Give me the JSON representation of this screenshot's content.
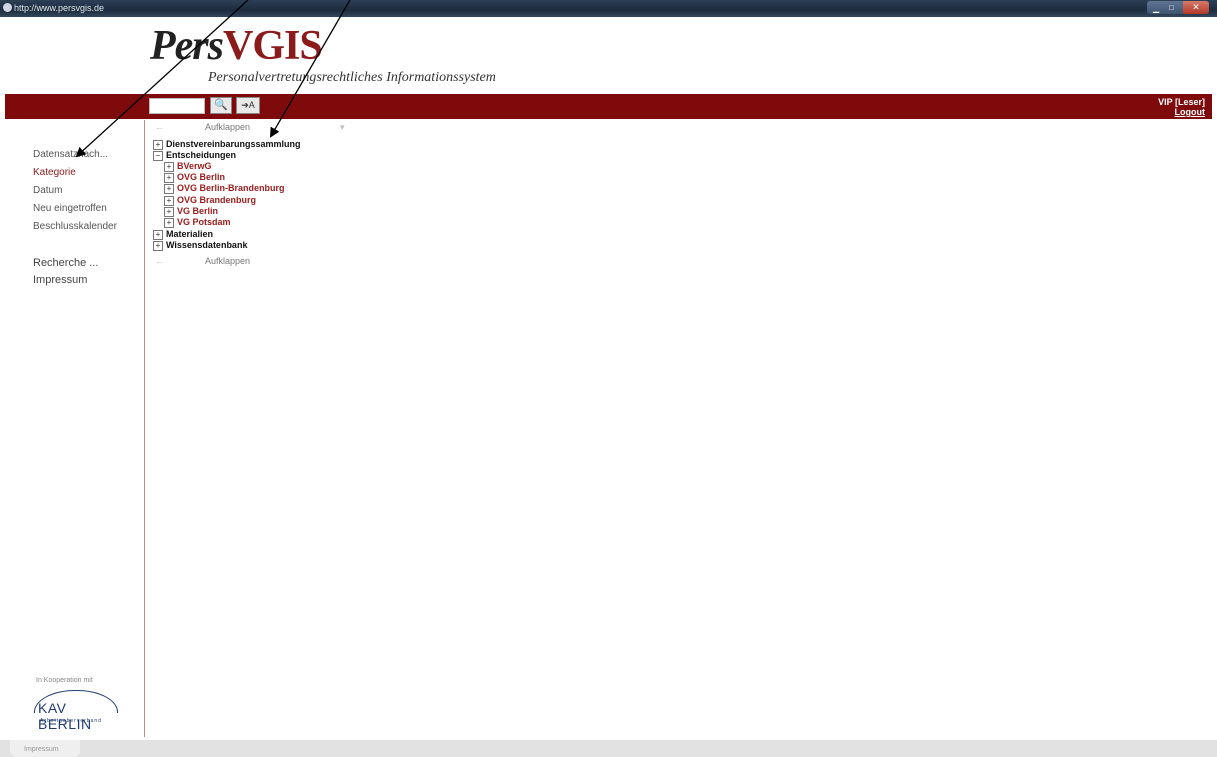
{
  "window": {
    "url": "http://www.persvgis.de"
  },
  "logo": {
    "pers": "Pers",
    "vgis": "VGIS",
    "subtitle": "Personalvertretungsrechtliches Informationssystem"
  },
  "header": {
    "search_icon": "search-icon",
    "goto_icon": "goto-icon",
    "user": "VIP [Leser]",
    "logout": "Logout"
  },
  "sidebar": {
    "items": [
      {
        "label": "Datensatznach..."
      },
      {
        "label": "Kategorie"
      },
      {
        "label": "Datum"
      },
      {
        "label": "Neu eingetroffen"
      },
      {
        "label": "Beschlusskalender"
      }
    ],
    "secondary": [
      {
        "label": "Recherche ..."
      },
      {
        "label": "Impressum"
      }
    ],
    "cooperation_text": "In Kooperation mit",
    "partner_logo_name": "KAV BERLIN",
    "partner_logo_sub": "Arbeitgeberverband"
  },
  "toolbar": {
    "collapse_label": "Aufklappen"
  },
  "tree": {
    "nodes": [
      {
        "label": "Dienstvereinbarungssammlung",
        "expander": "+"
      },
      {
        "label": "Entscheidungen",
        "expander": "−",
        "children": [
          {
            "label": "BVerwG",
            "expander": "+"
          },
          {
            "label": "OVG Berlin",
            "expander": "+"
          },
          {
            "label": "OVG Berlin-Brandenburg",
            "expander": "+"
          },
          {
            "label": "OVG Brandenburg",
            "expander": "+"
          },
          {
            "label": "VG Berlin",
            "expander": "+"
          },
          {
            "label": "VG Potsdam",
            "expander": "+"
          }
        ]
      },
      {
        "label": "Materialien",
        "expander": "+"
      },
      {
        "label": "Wissensdatenbank",
        "expander": "+"
      }
    ]
  },
  "statusbar": {
    "impressum": "Impressum"
  },
  "colors": {
    "brand_red": "#7e0a0c",
    "link_red": "#9b1b1b"
  }
}
